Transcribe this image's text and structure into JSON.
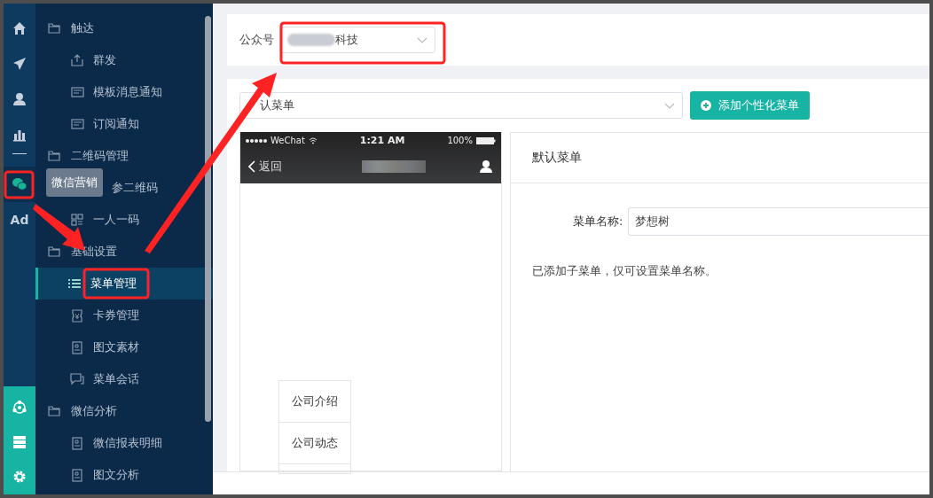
{
  "rail": {
    "items": [
      {
        "kind": "home",
        "selected": false
      },
      {
        "kind": "send",
        "selected": false
      },
      {
        "kind": "user",
        "selected": false
      },
      {
        "kind": "chart",
        "selected": false
      },
      {
        "kind": "wechat",
        "selected": true
      },
      {
        "kind": "text",
        "label": "Ad",
        "selected": false
      }
    ],
    "bottom": [
      {
        "kind": "hub"
      },
      {
        "kind": "server"
      },
      {
        "kind": "gear"
      }
    ],
    "tooltip": "微信营销"
  },
  "sidebar": {
    "groups": [
      {
        "label": "触达",
        "children": [
          {
            "label": "群发",
            "kind": "upload",
            "selected": false
          },
          {
            "label": "模板消息通知",
            "kind": "doc",
            "selected": false
          },
          {
            "label": "订阅通知",
            "kind": "doc",
            "selected": false
          }
        ]
      },
      {
        "label": "二维码管理",
        "children": [
          {
            "label": "参二维码",
            "kind": "none",
            "selected": false
          },
          {
            "label": "一人一码",
            "kind": "qr",
            "selected": false
          }
        ]
      },
      {
        "label": "基础设置",
        "children": [
          {
            "label": "菜单管理",
            "kind": "list",
            "selected": true
          },
          {
            "label": "卡券管理",
            "kind": "ticket",
            "selected": false
          },
          {
            "label": "图文素材",
            "kind": "page",
            "selected": false
          },
          {
            "label": "菜单会话",
            "kind": "chat",
            "selected": false
          }
        ]
      },
      {
        "label": "微信分析",
        "children": [
          {
            "label": "微信报表明细",
            "kind": "page",
            "selected": false
          },
          {
            "label": "图文分析",
            "kind": "page",
            "selected": false
          }
        ]
      }
    ]
  },
  "account": {
    "label": "公众号",
    "value": "科技"
  },
  "menu_select": {
    "value": "认菜单"
  },
  "add_button": "添加个性化菜单",
  "phone": {
    "carrier": "WeChat",
    "time": "1:21 AM",
    "battery": "100%",
    "back": "返回",
    "submenu": [
      "公司介绍",
      "公司动态"
    ]
  },
  "panel": {
    "title": "默认菜单",
    "name_label": "菜单名称:",
    "name_value": "梦想树",
    "note": "已添加子菜单，仅可设置菜单名称。"
  }
}
